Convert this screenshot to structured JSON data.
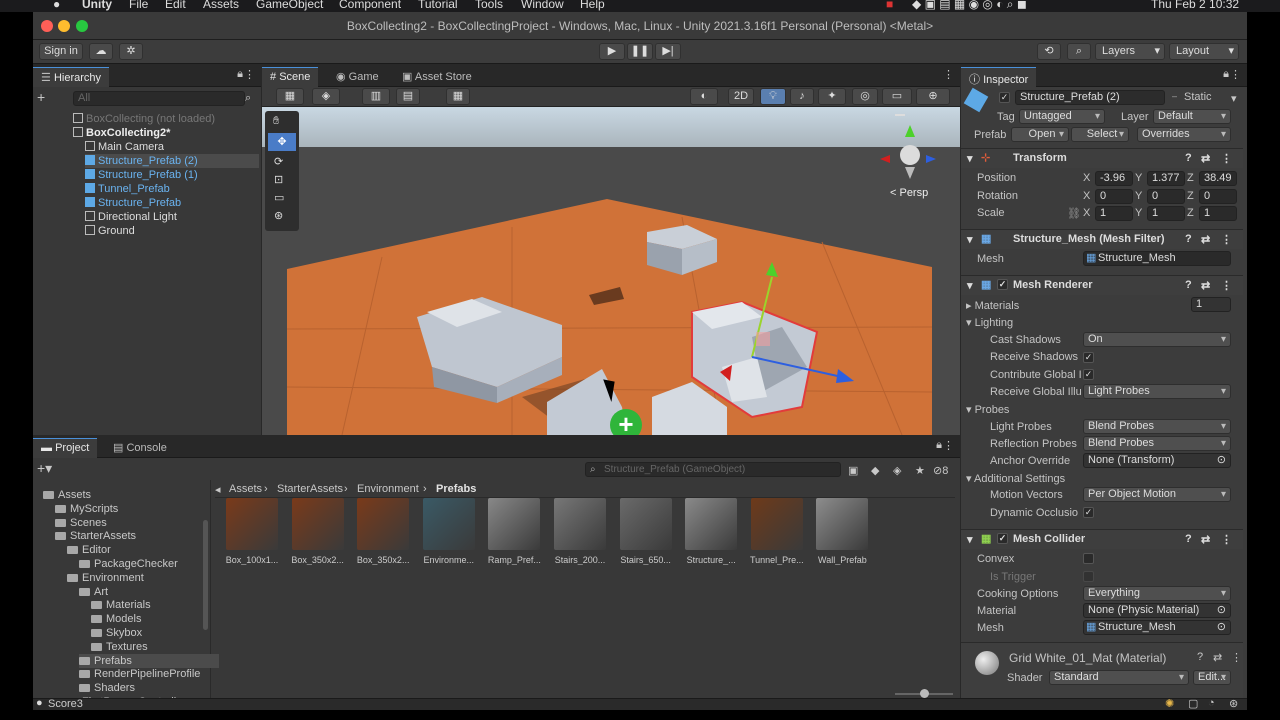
{
  "macbar": {
    "app": "Unity",
    "menus": [
      "File",
      "Edit",
      "Assets",
      "GameObject",
      "Component",
      "Tutorial",
      "Tools",
      "Window",
      "Help"
    ],
    "clock": "Thu Feb 2  10:32"
  },
  "window": {
    "title": "BoxCollecting2 - BoxCollectingProject - Windows, Mac, Linux - Unity 2021.3.16f1 Personal (Personal) <Metal>"
  },
  "toolbar": {
    "sign_in": "Sign in",
    "layers": "Layers",
    "layout": "Layout"
  },
  "hierarchy": {
    "tab": "Hierarchy",
    "search_placeholder": "All",
    "items": [
      {
        "label": "BoxCollecting (not loaded)",
        "indent": 0
      },
      {
        "label": "BoxCollecting2*",
        "indent": 0
      },
      {
        "label": "Main Camera",
        "indent": 1
      },
      {
        "label": "Structure_Prefab (2)",
        "indent": 1
      },
      {
        "label": "Structure_Prefab (1)",
        "indent": 1
      },
      {
        "label": "Tunnel_Prefab",
        "indent": 1
      },
      {
        "label": "Structure_Prefab",
        "indent": 1
      },
      {
        "label": "Directional Light",
        "indent": 1
      },
      {
        "label": "Ground",
        "indent": 1
      }
    ]
  },
  "scene": {
    "tabs": [
      "Scene",
      "Game",
      "Asset Store"
    ],
    "mode_2d": "2D",
    "persp": "< Persp"
  },
  "inspector": {
    "tab": "Inspector",
    "object_name": "Structure_Prefab (2)",
    "static_label": "Static",
    "tag_label": "Tag",
    "tag_value": "Untagged",
    "layer_label": "Layer",
    "layer_value": "Default",
    "prefab_label": "Prefab",
    "prefab_open": "Open",
    "prefab_select": "Select",
    "prefab_overrides": "Overrides",
    "transform": {
      "header": "Transform",
      "position_label": "Position",
      "rotation_label": "Rotation",
      "scale_label": "Scale",
      "position": {
        "x": "-3.96",
        "y": "1.377",
        "z": "38.49"
      },
      "rotation": {
        "x": "0",
        "y": "0",
        "z": "0"
      },
      "scale": {
        "x": "1",
        "y": "1",
        "z": "1"
      }
    },
    "mesh_filter": {
      "header": "Structure_Mesh (Mesh Filter)",
      "mesh_label": "Mesh",
      "mesh_value": "Structure_Mesh"
    },
    "mesh_renderer": {
      "header": "Mesh Renderer",
      "materials_label": "Materials",
      "materials_count": "1",
      "lighting_label": "Lighting",
      "cast_shadows_label": "Cast Shadows",
      "cast_shadows_value": "On",
      "receive_shadows_label": "Receive Shadows",
      "contribute_gi_label": "Contribute Global I",
      "receive_gi_label": "Receive Global Illu",
      "receive_gi_value": "Light Probes",
      "probes_label": "Probes",
      "light_probes_label": "Light Probes",
      "light_probes_value": "Blend Probes",
      "reflection_probes_label": "Reflection Probes",
      "reflection_probes_value": "Blend Probes",
      "anchor_override_label": "Anchor Override",
      "anchor_override_value": "None (Transform)",
      "additional_label": "Additional Settings",
      "motion_vectors_label": "Motion Vectors",
      "motion_vectors_value": "Per Object Motion",
      "dynamic_occlusion_label": "Dynamic Occlusio"
    },
    "mesh_collider": {
      "header": "Mesh Collider",
      "convex_label": "Convex",
      "is_trigger_label": "Is Trigger",
      "cooking_label": "Cooking Options",
      "cooking_value": "Everything",
      "material_label": "Material",
      "material_value": "None (Physic Material)",
      "mesh_label": "Mesh",
      "mesh_value": "Structure_Mesh"
    },
    "material": {
      "name": "Grid White_01_Mat (Material)",
      "shader_label": "Shader",
      "shader_value": "Standard",
      "edit_label": "Edit..."
    }
  },
  "project": {
    "tabs": [
      "Project",
      "Console"
    ],
    "search_value": "Structure_Prefab (GameObject)",
    "badge_count": "8",
    "breadcrumb": [
      "Assets",
      "StarterAssets",
      "Environment",
      "Prefabs"
    ],
    "tree": [
      {
        "label": "Assets",
        "indent": 0
      },
      {
        "label": "MyScripts",
        "indent": 1
      },
      {
        "label": "Scenes",
        "indent": 1
      },
      {
        "label": "StarterAssets",
        "indent": 1
      },
      {
        "label": "Editor",
        "indent": 2
      },
      {
        "label": "PackageChecker",
        "indent": 3
      },
      {
        "label": "Environment",
        "indent": 2
      },
      {
        "label": "Art",
        "indent": 3
      },
      {
        "label": "Materials",
        "indent": 4
      },
      {
        "label": "Models",
        "indent": 4
      },
      {
        "label": "Skybox",
        "indent": 4
      },
      {
        "label": "Textures",
        "indent": 4
      },
      {
        "label": "Prefabs",
        "indent": 3
      },
      {
        "label": "RenderPipelineProfile",
        "indent": 3
      },
      {
        "label": "Shaders",
        "indent": 3
      },
      {
        "label": "FirstPersonController",
        "indent": 2
      }
    ],
    "assets": [
      {
        "label": "Box_100x1...",
        "color": "#7a3a1a"
      },
      {
        "label": "Box_350x2...",
        "color": "#7a3a1a"
      },
      {
        "label": "Box_350x2...",
        "color": "#7a3a1a"
      },
      {
        "label": "Environme...",
        "color": "#3a5a66"
      },
      {
        "label": "Ramp_Pref...",
        "color": "#888888"
      },
      {
        "label": "Stairs_200...",
        "color": "#777777"
      },
      {
        "label": "Stairs_650...",
        "color": "#6a6a6a"
      },
      {
        "label": "Structure_...",
        "color": "#8a8a8a"
      },
      {
        "label": "Tunnel_Pre...",
        "color": "#6e3a1a"
      },
      {
        "label": "Wall_Prefab",
        "color": "#8d8d8d"
      }
    ]
  },
  "status": {
    "text": "Score3"
  }
}
